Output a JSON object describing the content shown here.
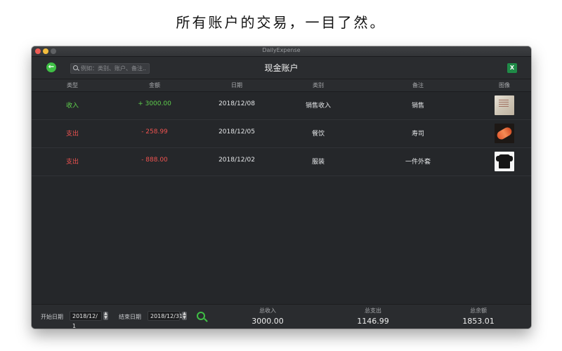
{
  "headline": "所有账户的交易，一目了然。",
  "window": {
    "title": "DailyExpense"
  },
  "toolbar": {
    "back_icon": "arrow-left-icon",
    "search_placeholder": "例如：类别、账户、备注...",
    "page_title": "现金账户",
    "export_icon": "excel-icon"
  },
  "colors": {
    "accent": "#3fbf45",
    "income": "#5fcf4d",
    "expense": "#ef5350",
    "background": "#25272a"
  },
  "columns": [
    "类型",
    "金额",
    "日期",
    "类别",
    "备注",
    "图像"
  ],
  "rows": [
    {
      "type": "收入",
      "amount": "+ 3000.00",
      "date": "2018/12/08",
      "category": "销售收入",
      "note": "销售",
      "image": "receipt-thumbnail"
    },
    {
      "type": "支出",
      "amount": "- 258.99",
      "date": "2018/12/05",
      "category": "餐饮",
      "note": "寿司",
      "image": "sushi-thumbnail"
    },
    {
      "type": "支出",
      "amount": "- 888.00",
      "date": "2018/12/02",
      "category": "服装",
      "note": "一件外套",
      "image": "jacket-thumbnail"
    }
  ],
  "footer": {
    "start_label": "开始日期",
    "start_value": "2018/12/ 1",
    "end_label": "结束日期",
    "end_value": "2018/12/31",
    "search_icon": "search-icon",
    "summary": [
      {
        "label": "总收入",
        "value": "3000.00"
      },
      {
        "label": "总支出",
        "value": "1146.99"
      },
      {
        "label": "总余额",
        "value": "1853.01"
      }
    ]
  }
}
